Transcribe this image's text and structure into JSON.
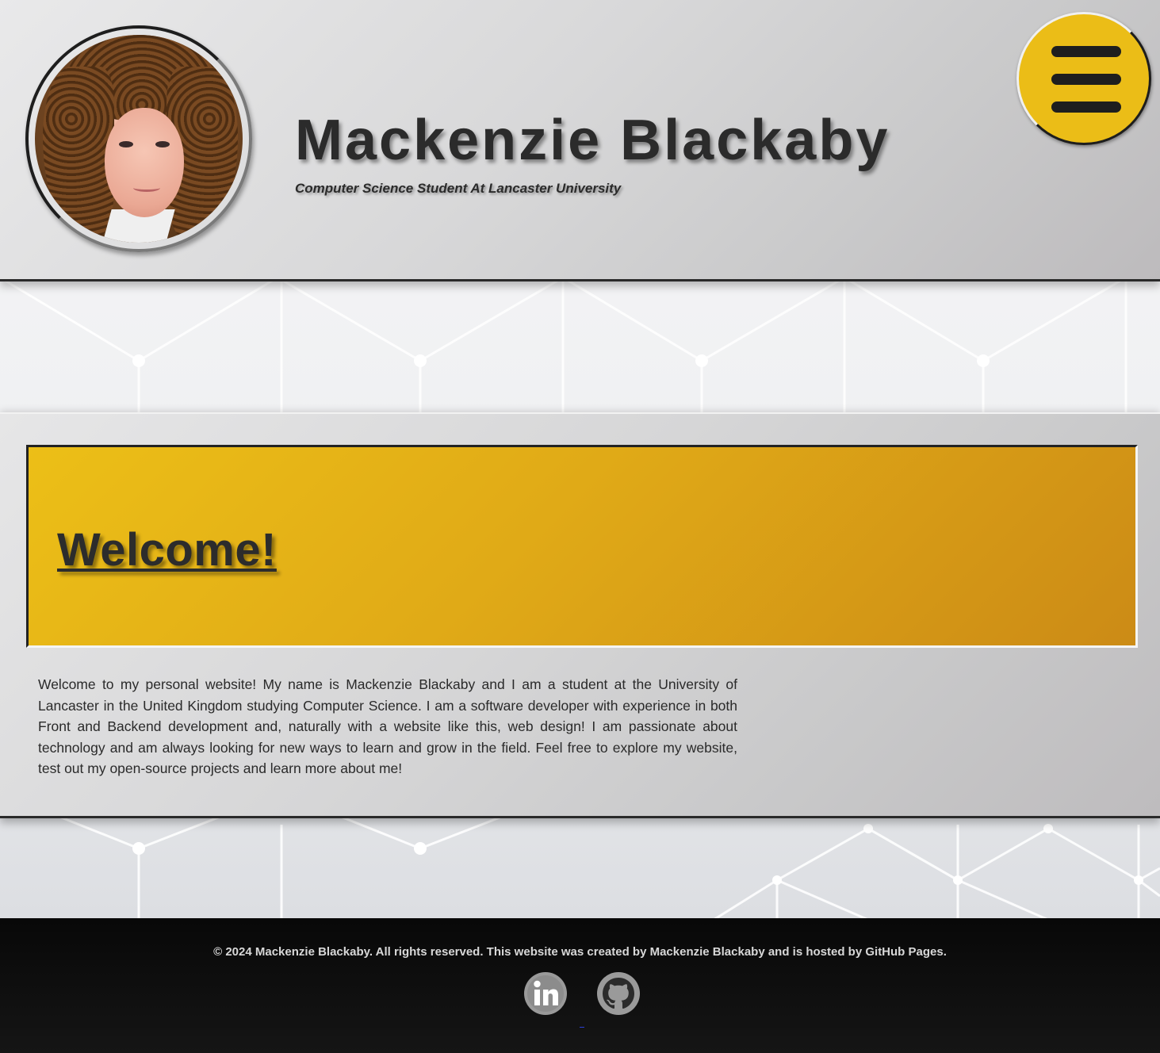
{
  "header": {
    "name": "Mackenzie Blackaby",
    "subtitle": "Computer Science Student At Lancaster University",
    "menu_icon": "hamburger-menu-icon",
    "accent_color": "#ebbd17"
  },
  "main": {
    "heading": "Welcome!",
    "intro": "Welcome to my personal website! My name is Mackenzie Blackaby and I am a student at the University of Lancaster in the United Kingdom studying Computer Science. I am a software developer with experience in both Front and Backend development and, naturally with a website like this, web design! I am passionate about technology and am always looking for new ways to learn and grow in the field. Feel free to explore my website, test out my open-source projects and learn more about me!"
  },
  "footer": {
    "copyright": "© 2024 Mackenzie Blackaby. All rights reserved. This website was created by Mackenzie Blackaby and is hosted by GitHub Pages.",
    "social": [
      {
        "icon": "linkedin-icon"
      },
      {
        "icon": "github-icon"
      }
    ]
  }
}
